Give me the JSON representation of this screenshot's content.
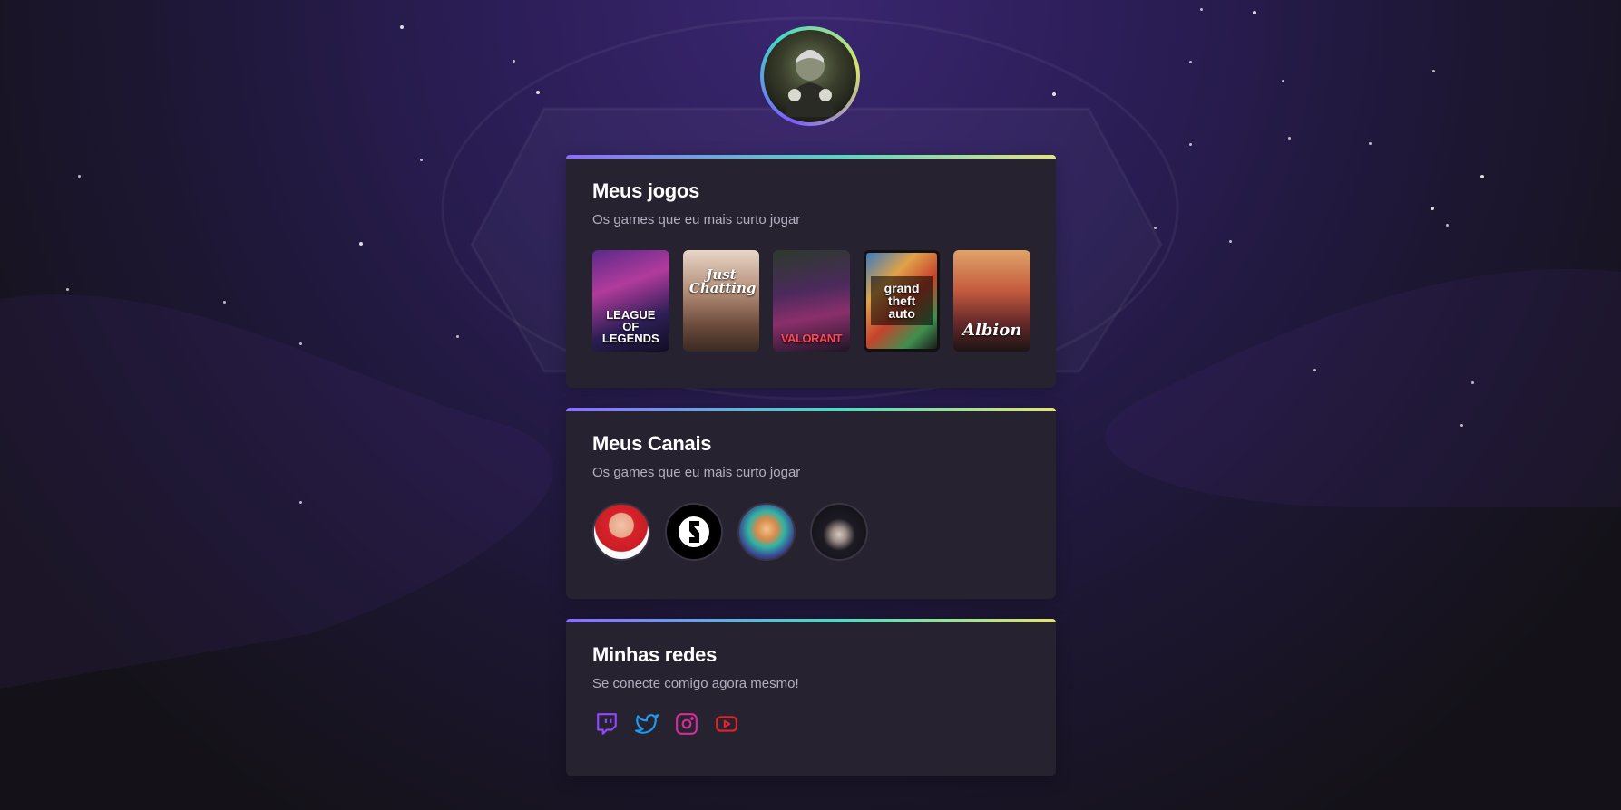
{
  "profile": {
    "avatar_icon": "profile-avatar-portrait"
  },
  "colors": {
    "accent_gradient": [
      "#8b6cff",
      "#4fd9c1",
      "#e3e279"
    ],
    "card_bg": "#26222f",
    "twitch": "#9146ff",
    "twitter": "#1d9bf0",
    "instagram": "#d12e98",
    "youtube": "#e0242a"
  },
  "games_section": {
    "title": "Meus jogos",
    "subtitle": "Os games que eu mais curto jogar",
    "games": [
      {
        "label": "LEAGUE OF LEGENDS",
        "icon": "league-of-legends-cover"
      },
      {
        "label": "Just Chatting",
        "icon": "just-chatting-cover"
      },
      {
        "label": "VALORANT",
        "icon": "valorant-cover"
      },
      {
        "label": "grand theft auto",
        "icon": "gta-v-cover"
      },
      {
        "label": "Albion",
        "icon": "albion-online-cover"
      }
    ]
  },
  "channels_section": {
    "title": "Meus Canais",
    "subtitle": "Os games que eu mais curto jogar",
    "channels": [
      {
        "icon": "channel-avatar-red-glasses"
      },
      {
        "icon": "channel-avatar-logo"
      },
      {
        "icon": "channel-avatar-hero"
      },
      {
        "icon": "channel-avatar-dark-hair"
      }
    ]
  },
  "social_section": {
    "title": "Minhas redes",
    "subtitle": "Se conecte comigo agora mesmo!",
    "links": [
      {
        "icon": "twitch-icon"
      },
      {
        "icon": "twitter-icon"
      },
      {
        "icon": "instagram-icon"
      },
      {
        "icon": "youtube-icon"
      }
    ]
  }
}
